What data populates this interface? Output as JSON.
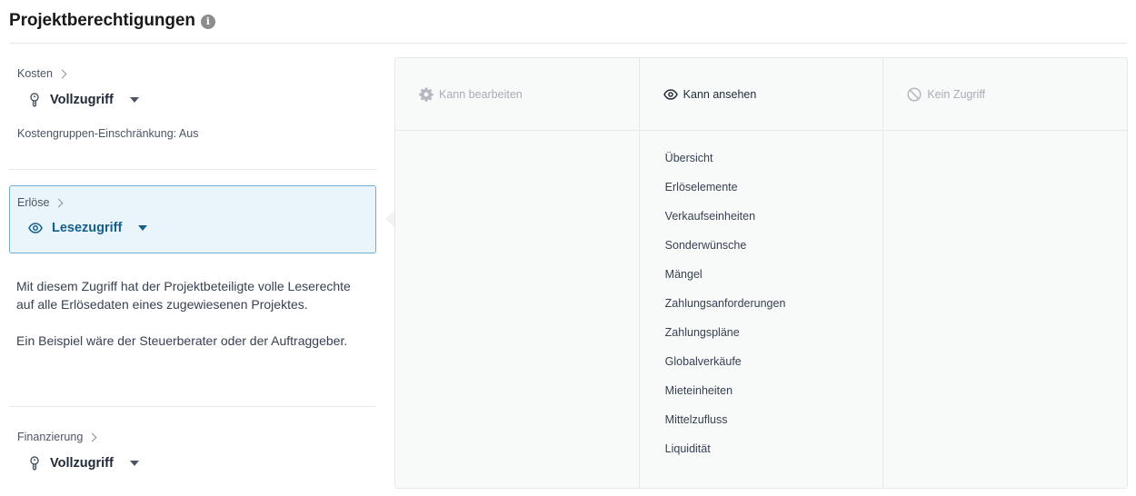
{
  "header": {
    "title": "Projektberechtigungen",
    "info_icon": "info-icon"
  },
  "left": {
    "kosten": {
      "label": "Kosten",
      "access": "Vollzugriff",
      "icon": "key-icon",
      "sub": "Kostengruppen-Einschränkung: Aus"
    },
    "erloese": {
      "label": "Erlöse",
      "access": "Lesezugriff",
      "icon": "eye-icon",
      "accent": "#135f8c",
      "border": "#6fb0d3",
      "background": "#eaf5fb"
    },
    "description": {
      "p1": "Mit diesem Zugriff hat der Projektbeteiligte volle Leserechte auf alle Erlösedaten eines zugewiesenen Projektes.",
      "p2": "Ein Beispiel wäre der Steuerberater oder der Auftraggeber."
    },
    "finanzierung": {
      "label": "Finanzierung",
      "access": "Vollzugriff",
      "icon": "key-icon"
    }
  },
  "panel": {
    "columns": [
      {
        "title": "Kann bearbeiten",
        "icon": "gear-icon",
        "state": "disabled",
        "items": []
      },
      {
        "title": "Kann ansehen",
        "icon": "eye-icon",
        "state": "active",
        "items": [
          "Übersicht",
          "Erlöselemente",
          "Verkaufseinheiten",
          "Sonderwünsche",
          "Mängel",
          "Zahlungsanforderungen",
          "Zahlungspläne",
          "Globalverkäufe",
          "Mieteinheiten",
          "Mittelzufluss",
          "Liquidität"
        ]
      },
      {
        "title": "Kein Zugriff",
        "icon": "no-access-icon",
        "state": "disabled",
        "items": []
      }
    ]
  }
}
